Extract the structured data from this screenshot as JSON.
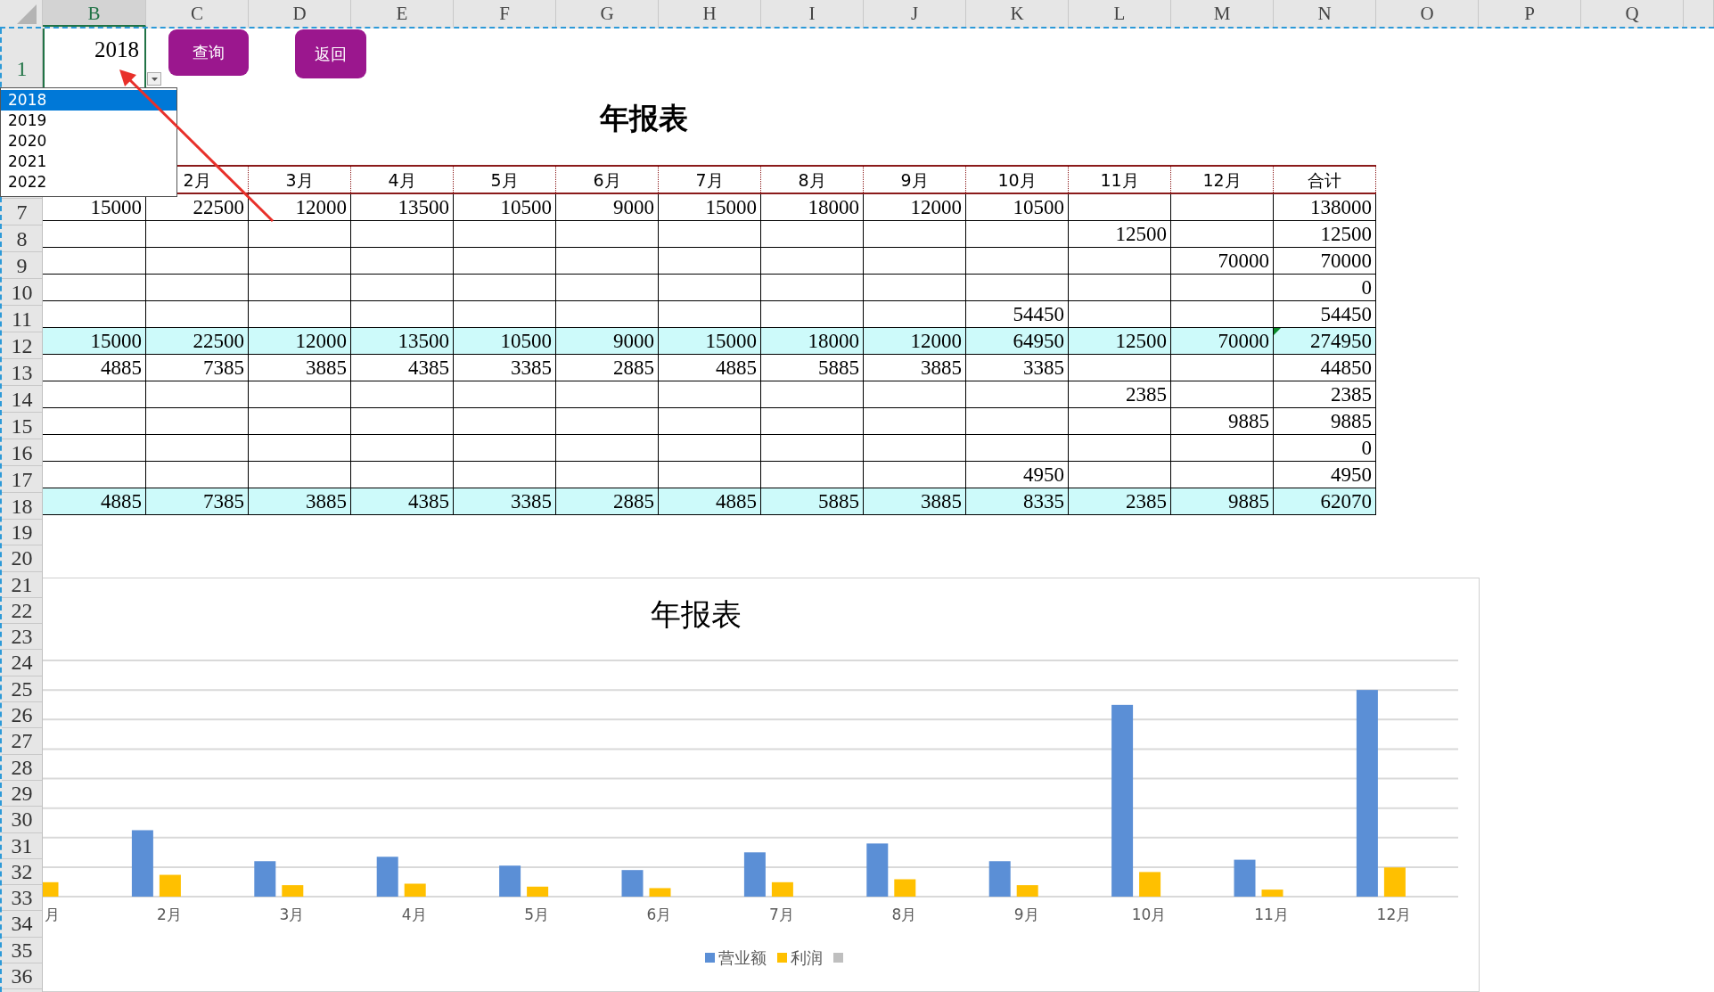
{
  "columns": [
    {
      "label": "B",
      "selected": true
    },
    {
      "label": "C",
      "selected": false
    },
    {
      "label": "D",
      "selected": false
    },
    {
      "label": "E",
      "selected": false
    },
    {
      "label": "F",
      "selected": false
    },
    {
      "label": "G",
      "selected": false
    },
    {
      "label": "H",
      "selected": false
    },
    {
      "label": "I",
      "selected": false
    },
    {
      "label": "J",
      "selected": false
    },
    {
      "label": "K",
      "selected": false
    },
    {
      "label": "L",
      "selected": false
    },
    {
      "label": "M",
      "selected": false
    },
    {
      "label": "N",
      "selected": false
    },
    {
      "label": "O",
      "selected": false
    },
    {
      "label": "P",
      "selected": false
    },
    {
      "label": "Q",
      "selected": false
    }
  ],
  "row_headers": [
    {
      "label": "1",
      "selected": true
    },
    {
      "label": "7",
      "selected": false
    },
    {
      "label": "8",
      "selected": false
    },
    {
      "label": "9",
      "selected": false
    },
    {
      "label": "10",
      "selected": false
    },
    {
      "label": "11",
      "selected": false
    },
    {
      "label": "12",
      "selected": false
    },
    {
      "label": "13",
      "selected": false
    },
    {
      "label": "14",
      "selected": false
    },
    {
      "label": "15",
      "selected": false
    },
    {
      "label": "16",
      "selected": false
    },
    {
      "label": "17",
      "selected": false
    },
    {
      "label": "18",
      "selected": false
    },
    {
      "label": "19",
      "selected": false
    },
    {
      "label": "20",
      "selected": false
    },
    {
      "label": "21",
      "selected": false
    },
    {
      "label": "22",
      "selected": false
    },
    {
      "label": "23",
      "selected": false
    },
    {
      "label": "24",
      "selected": false
    },
    {
      "label": "25",
      "selected": false
    },
    {
      "label": "26",
      "selected": false
    },
    {
      "label": "27",
      "selected": false
    },
    {
      "label": "28",
      "selected": false
    },
    {
      "label": "29",
      "selected": false
    },
    {
      "label": "30",
      "selected": false
    },
    {
      "label": "31",
      "selected": false
    },
    {
      "label": "32",
      "selected": false
    },
    {
      "label": "33",
      "selected": false
    },
    {
      "label": "34",
      "selected": false
    },
    {
      "label": "35",
      "selected": false
    },
    {
      "label": "36",
      "selected": false
    }
  ],
  "year_cell": {
    "value": "2018"
  },
  "buttons": [
    "查询",
    "返回"
  ],
  "year_dropdown": [
    {
      "label": "2018",
      "selected": true
    },
    {
      "label": "2019",
      "selected": false
    },
    {
      "label": "2020",
      "selected": false
    },
    {
      "label": "2021",
      "selected": false
    },
    {
      "label": "2022",
      "selected": false
    }
  ],
  "report_title": "年报表",
  "table": {
    "header": {
      "C": "2月",
      "D": "3月",
      "E": "4月",
      "F": "5月",
      "G": "6月",
      "H": "7月",
      "I": "8月",
      "J": "9月",
      "K": "10月",
      "L": "11月",
      "M": "12月",
      "N": "合计"
    },
    "rows": [
      {
        "kind": "detail",
        "cells": {
          "B": "15000",
          "C": "22500",
          "D": "12000",
          "E": "13500",
          "F": "10500",
          "G": "9000",
          "H": "15000",
          "I": "18000",
          "J": "12000",
          "K": "10500",
          "N": "138000"
        }
      },
      {
        "kind": "detail",
        "cells": {
          "L": "12500",
          "N": "12500"
        }
      },
      {
        "kind": "detail",
        "cells": {
          "M": "70000",
          "N": "70000"
        }
      },
      {
        "kind": "detail",
        "cells": {
          "N": "0"
        }
      },
      {
        "kind": "detail",
        "cells": {
          "K": "54450",
          "N": "54450"
        }
      },
      {
        "kind": "total",
        "cells": {
          "B": "15000",
          "C": "22500",
          "D": "12000",
          "E": "13500",
          "F": "10500",
          "G": "9000",
          "H": "15000",
          "I": "18000",
          "J": "12000",
          "K": "64950",
          "L": "12500",
          "M": "70000",
          "N": {
            "text": "274950",
            "flagged": true
          }
        }
      },
      {
        "kind": "detail",
        "cells": {
          "B": "4885",
          "C": "7385",
          "D": "3885",
          "E": "4385",
          "F": "3385",
          "G": "2885",
          "H": "4885",
          "I": "5885",
          "J": "3885",
          "K": "3385",
          "N": "44850"
        }
      },
      {
        "kind": "detail",
        "cells": {
          "L": "2385",
          "N": "2385"
        }
      },
      {
        "kind": "detail",
        "cells": {
          "M": "9885",
          "N": "9885"
        }
      },
      {
        "kind": "detail",
        "cells": {
          "N": "0"
        }
      },
      {
        "kind": "detail",
        "cells": {
          "K": "4950",
          "N": "4950"
        }
      },
      {
        "kind": "total",
        "cells": {
          "B": "4885",
          "C": "7385",
          "D": "3885",
          "E": "4385",
          "F": "3385",
          "G": "2885",
          "H": "4885",
          "I": "5885",
          "J": "3885",
          "K": "8335",
          "L": "2385",
          "M": "9885",
          "N": "62070"
        }
      }
    ]
  },
  "chart": {
    "title": "年报表",
    "categories": [
      "月",
      "2月",
      "3月",
      "4月",
      "5月",
      "6月",
      "7月",
      "8月",
      "9月",
      "10月",
      "11月",
      "12月"
    ],
    "legend": [
      {
        "name": "营业额",
        "color": "#5b8fd6"
      },
      {
        "name": "利润",
        "color": "#ffc000"
      },
      {
        "color": "#bfbfbf"
      }
    ]
  }
}
